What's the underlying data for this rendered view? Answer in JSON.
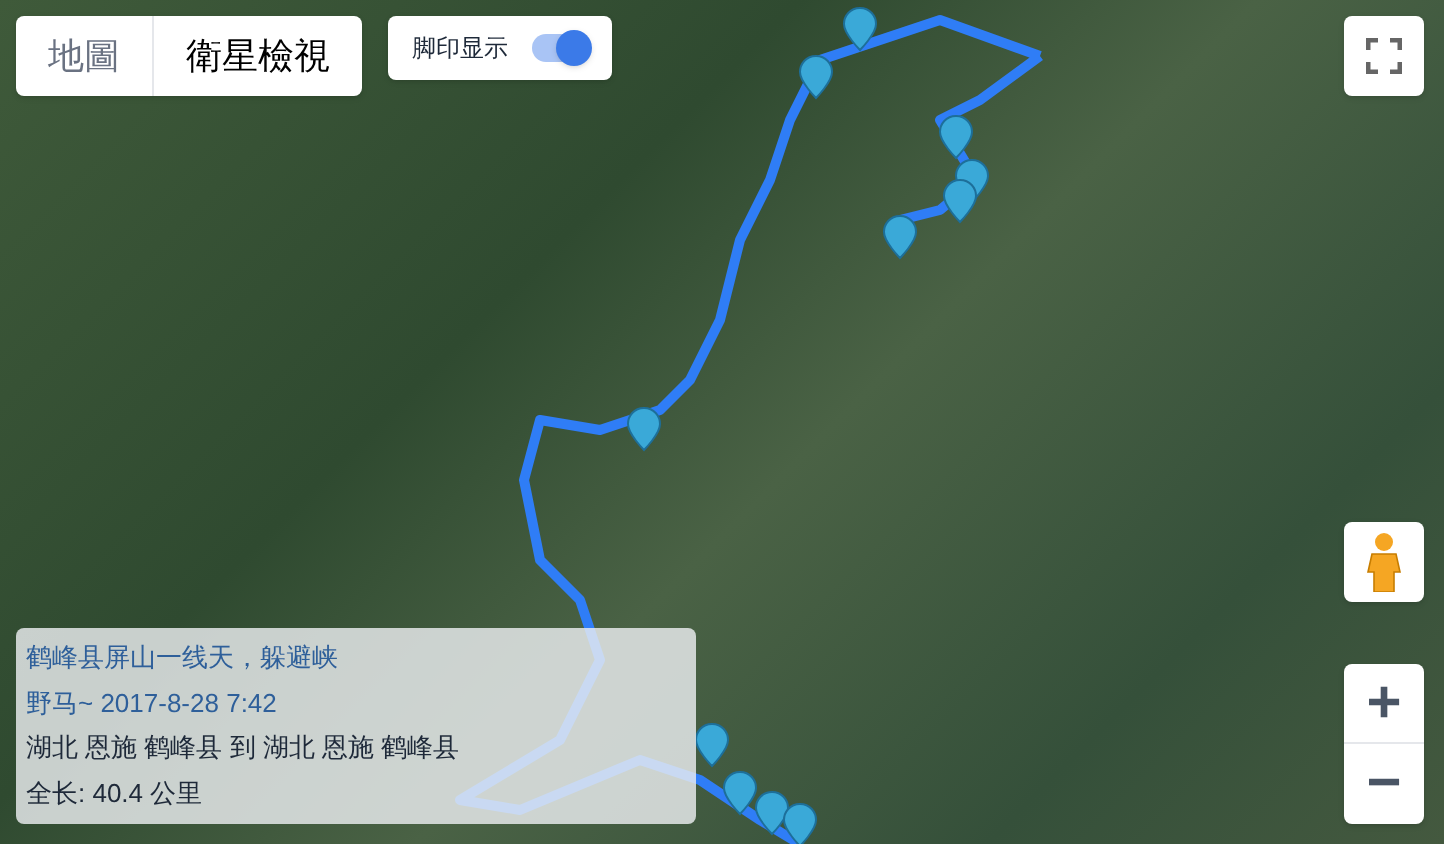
{
  "map_type_tabs": [
    {
      "label": "地圖",
      "selected": false
    },
    {
      "label": "衛星檢視",
      "selected": true
    }
  ],
  "footprint_toggle": {
    "label": "脚印显示",
    "on": true
  },
  "info_box": {
    "title": "鹤峰县屏山一线天，躲避峡",
    "author_date": "野马~ 2017-8-28 7:42",
    "route": "湖北 恩施 鹤峰县 到 湖北 恩施 鹤峰县",
    "length": "全长: 40.4 公里"
  },
  "zoom_controls": {
    "zoom_in": "+",
    "zoom_out": "−"
  }
}
